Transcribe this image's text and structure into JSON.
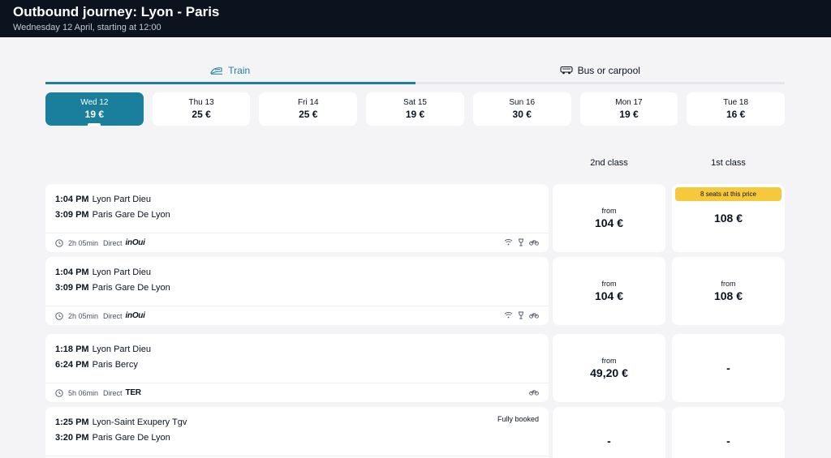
{
  "header": {
    "title": "Outbound journey: Lyon - Paris",
    "subtitle": "Wednesday 12 April, starting at 12:00"
  },
  "modes": [
    {
      "label": "Train",
      "icon": "train-icon",
      "active": true
    },
    {
      "label": "Bus or carpool",
      "icon": "bus-icon",
      "active": false
    }
  ],
  "dates": [
    {
      "day": "Wed 12",
      "price": "19 €",
      "active": true
    },
    {
      "day": "Thu 13",
      "price": "25 €"
    },
    {
      "day": "Fri 14",
      "price": "25 €"
    },
    {
      "day": "Sat 15",
      "price": "19 €"
    },
    {
      "day": "Sun 16",
      "price": "30 €"
    },
    {
      "day": "Mon 17",
      "price": "19 €"
    },
    {
      "day": "Tue 18",
      "price": "16 €"
    }
  ],
  "class_headers": {
    "second": "2nd class",
    "first": "1st class"
  },
  "journeys": [
    {
      "departure_time": "1:04 PM",
      "departure_station": "Lyon Part Dieu",
      "arrival_time": "3:09 PM",
      "arrival_station": "Paris Gare De Lyon",
      "duration": "2h 05min",
      "type": "Direct",
      "brand": "inOui",
      "amenities": [
        "wifi-icon",
        "bar-icon",
        "bike-icon"
      ],
      "second_class": {
        "from": "from",
        "price": "104 €"
      },
      "first_class": {
        "badge": "8 seats at this price",
        "price": "108 €"
      }
    },
    {
      "departure_time": "1:04 PM",
      "departure_station": "Lyon Part Dieu",
      "arrival_time": "3:09 PM",
      "arrival_station": "Paris Gare De Lyon",
      "duration": "2h 05min",
      "type": "Direct",
      "brand": "inOui",
      "amenities": [
        "wifi-icon",
        "bar-icon",
        "bike-icon"
      ],
      "second_class": {
        "from": "from",
        "price": "104 €"
      },
      "first_class": {
        "from": "from",
        "price": "108 €"
      }
    },
    {
      "departure_time": "1:18 PM",
      "departure_station": "Lyon Part Dieu",
      "arrival_time": "6:24 PM",
      "arrival_station": "Paris Bercy",
      "duration": "5h 06min",
      "type": "Direct",
      "brand": "TER",
      "amenities": [
        "bike-icon"
      ],
      "second_class": {
        "from": "from",
        "price": "49,20 €"
      },
      "first_class": {
        "dash": "-"
      }
    },
    {
      "departure_time": "1:25 PM",
      "departure_station": "Lyon-Saint Exupery Tgv",
      "arrival_time": "3:20 PM",
      "arrival_station": "Paris Gare De Lyon",
      "status": "Fully booked",
      "second_class": {
        "dash": "-"
      },
      "first_class": {
        "dash": "-"
      }
    }
  ]
}
